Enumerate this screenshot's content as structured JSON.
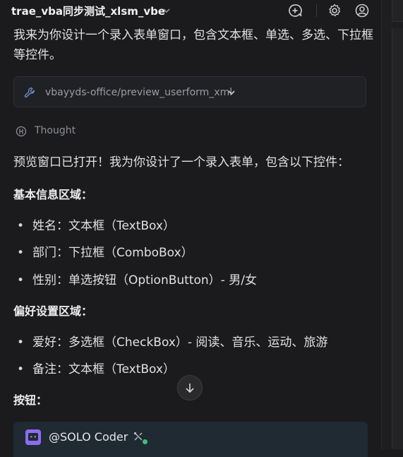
{
  "header": {
    "title": "trae_vba同步测试_xlsm_vbe",
    "icons": [
      "chevron-down-icon",
      "add-chat-icon",
      "settings-icon",
      "account-icon"
    ]
  },
  "user_message": "我来为你设计一个录入表单窗口，包含文本框、单选、多选、下拉框等控件。",
  "tool_call": {
    "label": "vbayyds-office/preview_userform_xml",
    "icon": "wrench-icon"
  },
  "thought": {
    "label": "Thought"
  },
  "response": {
    "intro": "预览窗口已打开！我为你设计了一个录入表单，包含以下控件：",
    "sections": [
      {
        "heading": "基本信息区域：",
        "items": [
          "姓名：文本框（TextBox）",
          "部门：下拉框（ComboBox）",
          "性别：单选按钮（OptionButton）- 男/女"
        ]
      },
      {
        "heading": "偏好设置区域：",
        "items": [
          "爱好：多选框（CheckBox）- 阅读、音乐、运动、旅游",
          "备注：文本框（TextBox）"
        ]
      },
      {
        "heading": "按钮：",
        "items": []
      }
    ]
  },
  "composer": {
    "agent_label": "@SOLO Coder"
  },
  "colors": {
    "background": "#1b1b1d",
    "accent": "#8d6cf0",
    "status_online": "#3fbf74",
    "tool_icon": "#6f8fd6"
  }
}
